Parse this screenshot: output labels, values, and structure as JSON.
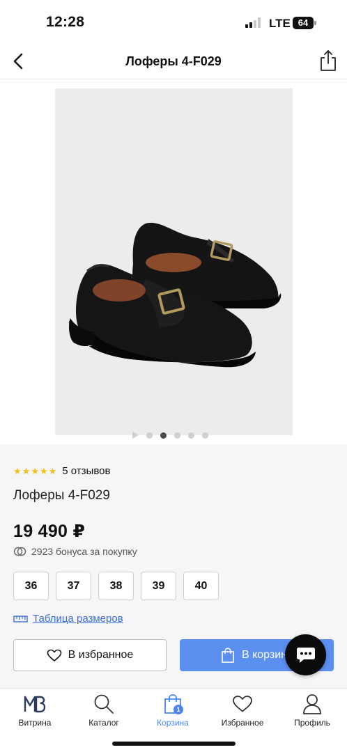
{
  "status_bar": {
    "time": "12:28",
    "network": "LTE",
    "battery": "64"
  },
  "header": {
    "title": "Лоферы 4-F029",
    "back_icon": "chevron-left-icon",
    "share_icon": "share-icon"
  },
  "gallery": {
    "slide_count": 5,
    "active_slide": 2,
    "has_video": true
  },
  "product": {
    "rating": 5,
    "reviews": "5 отзывов",
    "name": "Лоферы 4-F029",
    "price": "19 490 ₽",
    "bonus": "2923 бонуса за покупку",
    "sizes": [
      "36",
      "37",
      "38",
      "39",
      "40"
    ],
    "size_table": "Таблица размеров",
    "favorite_button": "В избранное",
    "cart_button": "В корзину"
  },
  "bottom_nav": {
    "items": [
      {
        "label": "Витрина",
        "icon": "mb-logo-icon"
      },
      {
        "label": "Каталог",
        "icon": "search-icon"
      },
      {
        "label": "Корзина",
        "icon": "bag-icon",
        "badge": "1",
        "active": true
      },
      {
        "label": "Избранное",
        "icon": "heart-icon"
      },
      {
        "label": "Профиль",
        "icon": "profile-icon"
      }
    ]
  },
  "colors": {
    "accent": "#4a86f0",
    "cart_button": "#5b8ff0",
    "star": "#f2bf1d",
    "link": "#3a6fd8",
    "info_background": "#f6f6f8"
  }
}
